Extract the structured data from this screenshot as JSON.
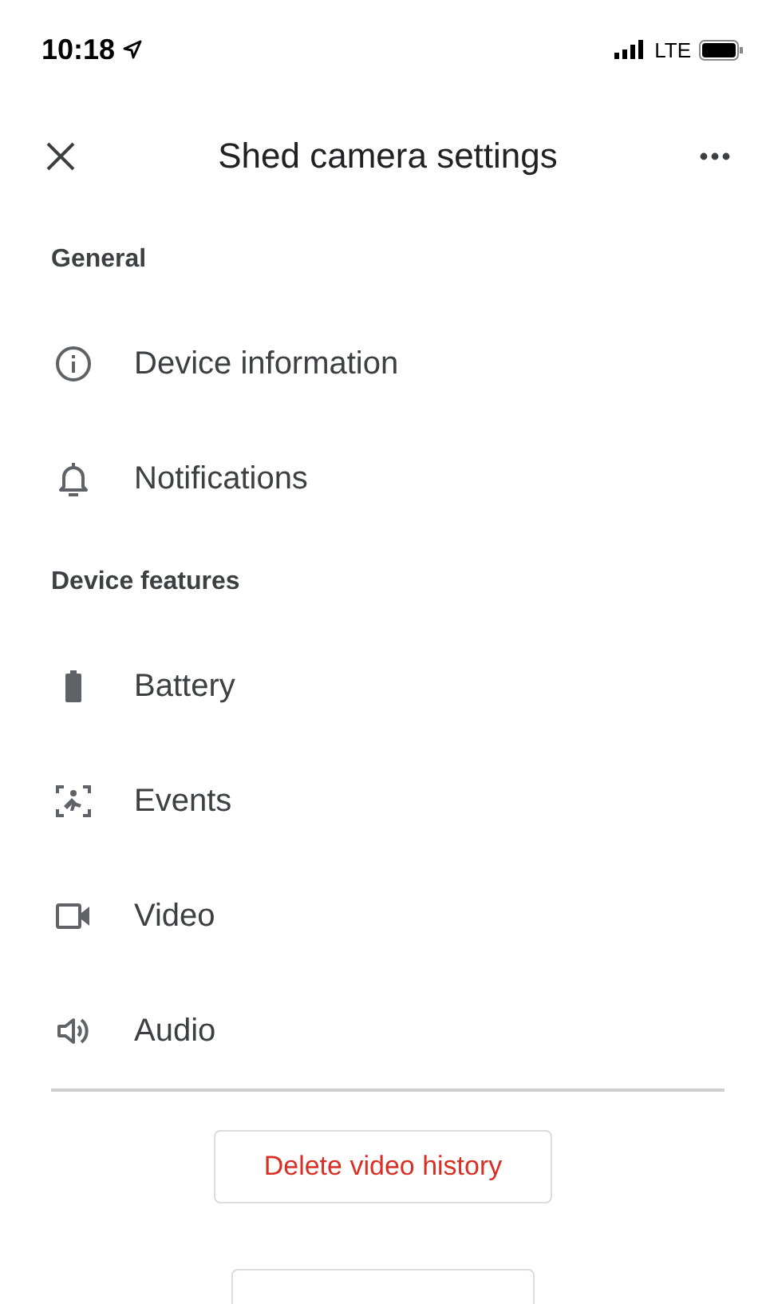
{
  "status_bar": {
    "time": "10:18",
    "network": "LTE"
  },
  "header": {
    "title": "Shed camera settings"
  },
  "sections": [
    {
      "title": "General",
      "items": [
        {
          "label": "Device information"
        },
        {
          "label": "Notifications"
        }
      ]
    },
    {
      "title": "Device features",
      "items": [
        {
          "label": "Battery"
        },
        {
          "label": "Events"
        },
        {
          "label": "Video"
        },
        {
          "label": "Audio"
        }
      ]
    }
  ],
  "buttons": [
    {
      "kind": "text",
      "label": "Delete video history"
    },
    {
      "kind": "cut_off"
    }
  ]
}
